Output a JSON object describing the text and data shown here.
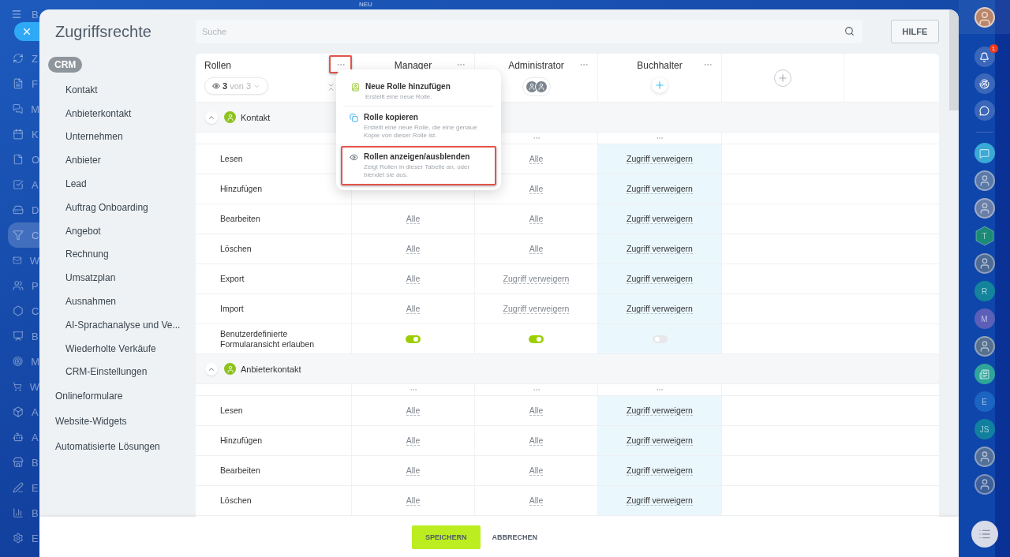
{
  "left_rail": {
    "header": "B",
    "items": [
      {
        "label": "Z",
        "selected": false
      },
      {
        "label": "F",
        "selected": false
      },
      {
        "label": "M",
        "selected": false
      },
      {
        "label": "K",
        "selected": false
      },
      {
        "label": "O",
        "selected": false
      },
      {
        "label": "A",
        "selected": false
      },
      {
        "label": "D",
        "selected": false
      },
      {
        "label": "C",
        "selected": true
      },
      {
        "label": "W",
        "selected": false
      },
      {
        "label": "P",
        "selected": false
      },
      {
        "label": "C",
        "selected": false
      },
      {
        "label": "B",
        "selected": false
      },
      {
        "label": "M",
        "selected": false
      },
      {
        "label": "W",
        "selected": false
      },
      {
        "label": "A",
        "selected": false
      },
      {
        "label": "A",
        "selected": false
      },
      {
        "label": "B",
        "selected": false
      },
      {
        "label": "E",
        "selected": false
      },
      {
        "label": "B",
        "selected": false
      },
      {
        "label": "E",
        "selected": false
      }
    ]
  },
  "top_bar": {
    "badge": "NEU"
  },
  "panel": {
    "title": "Zugriffsrechte",
    "nav": [
      {
        "label": "CRM",
        "selected": true,
        "children": [
          {
            "label": "Kontakt"
          },
          {
            "label": "Anbieterkontakt"
          },
          {
            "label": "Unternehmen"
          },
          {
            "label": "Anbieter"
          },
          {
            "label": "Lead"
          },
          {
            "label": "Auftrag Onboarding"
          },
          {
            "label": "Angebot"
          },
          {
            "label": "Rechnung"
          },
          {
            "label": "Umsatzplan"
          },
          {
            "label": "Ausnahmen"
          },
          {
            "label": "AI-Sprachanalyse und Ve..."
          },
          {
            "label": "Wiederholte Verkäufe"
          },
          {
            "label": "CRM-Einstellungen"
          }
        ]
      },
      {
        "label": "Onlineformulare",
        "selected": false
      },
      {
        "label": "Website-Widgets",
        "selected": false
      },
      {
        "label": "Automatisierte Lösungen",
        "selected": false
      }
    ],
    "search": {
      "placeholder": "Suche"
    },
    "help_button": "HILFE",
    "table": {
      "roles_header": {
        "title": "Rollen",
        "menu_open": true,
        "outlined": true,
        "filter": {
          "count": "3",
          "total": "von 3"
        }
      },
      "roles": [
        {
          "name": "Manager",
          "kind": "plain",
          "highlighted": false
        },
        {
          "name": "Administrator",
          "kind": "group",
          "highlighted": false
        },
        {
          "name": "Buchhalter",
          "kind": "add",
          "highlighted": true
        }
      ],
      "sections": [
        {
          "title": "Kontakt",
          "expanded": true,
          "dots": [
            false,
            true,
            true
          ],
          "rows": [
            {
              "label": "Lesen",
              "kind": "value",
              "cells": [
                null,
                {
                  "text": "Alle"
                },
                {
                  "text": "Zugriff verweigern"
                }
              ]
            },
            {
              "label": "Hinzufügen",
              "kind": "value",
              "cells": [
                null,
                {
                  "text": "Alle"
                },
                {
                  "text": "Zugriff verweigern"
                }
              ]
            },
            {
              "label": "Bearbeiten",
              "kind": "value",
              "cells": [
                {
                  "text": "Alle"
                },
                {
                  "text": "Alle"
                },
                {
                  "text": "Zugriff verweigern"
                }
              ]
            },
            {
              "label": "Löschen",
              "kind": "value",
              "cells": [
                {
                  "text": "Alle"
                },
                {
                  "text": "Alle"
                },
                {
                  "text": "Zugriff verweigern"
                }
              ]
            },
            {
              "label": "Export",
              "kind": "value",
              "cells": [
                {
                  "text": "Alle"
                },
                {
                  "text": "Zugriff verweigern"
                },
                {
                  "text": "Zugriff verweigern"
                }
              ]
            },
            {
              "label": "Import",
              "kind": "value",
              "cells": [
                {
                  "text": "Alle"
                },
                {
                  "text": "Zugriff verweigern"
                },
                {
                  "text": "Zugriff verweigern"
                }
              ]
            },
            {
              "label": "Benutzerdefinierte Formularansicht erlauben",
              "kind": "toggle",
              "cells": [
                {
                  "on": true
                },
                {
                  "on": true
                },
                {
                  "on": false
                }
              ]
            }
          ]
        },
        {
          "title": "Anbieterkontakt",
          "expanded": true,
          "dots": [
            true,
            true,
            true
          ],
          "rows": [
            {
              "label": "Lesen",
              "kind": "value",
              "cells": [
                {
                  "text": "Alle"
                },
                {
                  "text": "Alle"
                },
                {
                  "text": "Zugriff verweigern"
                }
              ]
            },
            {
              "label": "Hinzufügen",
              "kind": "value",
              "cells": [
                {
                  "text": "Alle"
                },
                {
                  "text": "Alle"
                },
                {
                  "text": "Zugriff verweigern"
                }
              ]
            },
            {
              "label": "Bearbeiten",
              "kind": "value",
              "cells": [
                {
                  "text": "Alle"
                },
                {
                  "text": "Alle"
                },
                {
                  "text": "Zugriff verweigern"
                }
              ]
            },
            {
              "label": "Löschen",
              "kind": "value",
              "cells": [
                {
                  "text": "Alle"
                },
                {
                  "text": "Alle"
                },
                {
                  "text": "Zugriff verweigern"
                }
              ]
            }
          ]
        }
      ]
    },
    "menu": {
      "items": [
        {
          "kind": "add",
          "title": "Neue Rolle hinzufügen",
          "description": "Erstellt eine neue Rolle.",
          "outlined": false
        },
        {
          "kind": "copy",
          "title": "Rolle kopieren",
          "description": "Erstellt eine neue Rolle, die eine genaue Kopie von dieser Rolle ist.",
          "outlined": false
        },
        {
          "kind": "visibility",
          "title": "Rollen anzeigen/ausblenden",
          "description": "Zeigt Rollen in dieser Tabelle an, oder blendet sie aus.",
          "outlined": true
        }
      ]
    },
    "footer": {
      "buttons": [
        {
          "label": "SPEICHERN",
          "kind": "primary"
        },
        {
          "label": "ABBRECHEN",
          "kind": "link"
        }
      ]
    }
  },
  "right_rail": {
    "notifications_badge": "1",
    "contacts": [
      {
        "kind": "app",
        "color": "#3aa9d6"
      },
      {
        "kind": "avatar",
        "color": "#5a78a8"
      },
      {
        "kind": "avatar",
        "color": "#6a7fa8"
      },
      {
        "kind": "hexagon",
        "text": "T",
        "color": "#1b8a77"
      },
      {
        "kind": "avatar",
        "color": "#4d6b94"
      },
      {
        "kind": "initials",
        "text": "R",
        "color": "#13849c"
      },
      {
        "kind": "initials",
        "text": "M",
        "color": "#5b5fb8"
      },
      {
        "kind": "avatar",
        "color": "#56708f"
      },
      {
        "kind": "app",
        "color": "#2ea59a"
      },
      {
        "kind": "initials",
        "text": "E",
        "color": "#1c64c2"
      },
      {
        "kind": "initials",
        "text": "JS",
        "color": "#11809e"
      },
      {
        "kind": "avatar",
        "color": "#52709a"
      },
      {
        "kind": "avatar",
        "color": "#3f5f9a"
      }
    ]
  }
}
